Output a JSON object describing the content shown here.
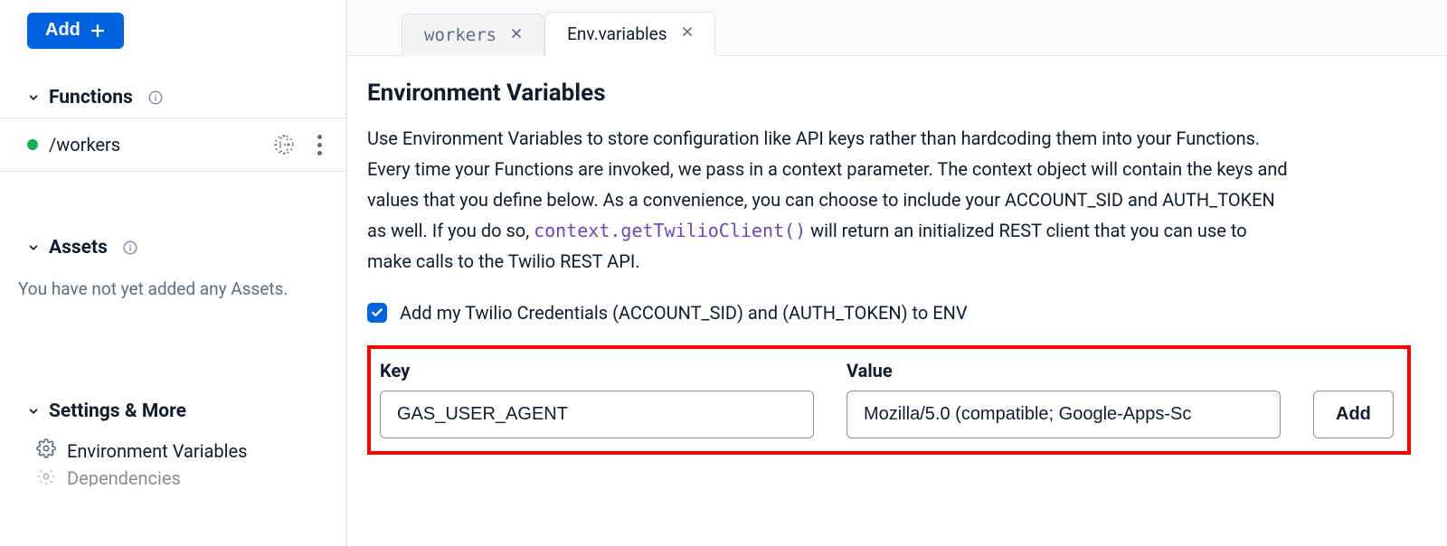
{
  "sidebar": {
    "add_button_label": "Add",
    "functions": {
      "header": "Functions",
      "items": [
        {
          "name": "/workers"
        }
      ]
    },
    "assets": {
      "header": "Assets",
      "empty_text": "You have not yet added any Assets."
    },
    "settings": {
      "header": "Settings & More",
      "items": [
        {
          "label": "Environment Variables"
        },
        {
          "label": "Dependencies"
        }
      ]
    }
  },
  "tabs": [
    {
      "label": "workers",
      "active": false
    },
    {
      "label": "Env.variables",
      "active": true
    }
  ],
  "main": {
    "title": "Environment Variables",
    "description_pre": "Use Environment Variables to store configuration like API keys rather than hardcoding them into your Functions. Every time your Functions are invoked, we pass in a context parameter. The context object will contain the keys and values that you define below. As a convenience, you can choose to include your ACCOUNT_SID and AUTH_TOKEN as well. If you do so, ",
    "description_code": "context.getTwilioClient()",
    "description_post": " will return an initialized REST client that you can use to make calls to the Twilio REST API.",
    "credentials_checkbox_label": "Add my Twilio Credentials (ACCOUNT_SID) and (AUTH_TOKEN) to ENV",
    "credentials_checkbox_checked": true,
    "env_form": {
      "key_label": "Key",
      "key_value": "GAS_USER_AGENT",
      "value_label": "Value",
      "value_value": "Mozilla/5.0 (compatible; Google-Apps-Sc",
      "add_label": "Add"
    }
  }
}
